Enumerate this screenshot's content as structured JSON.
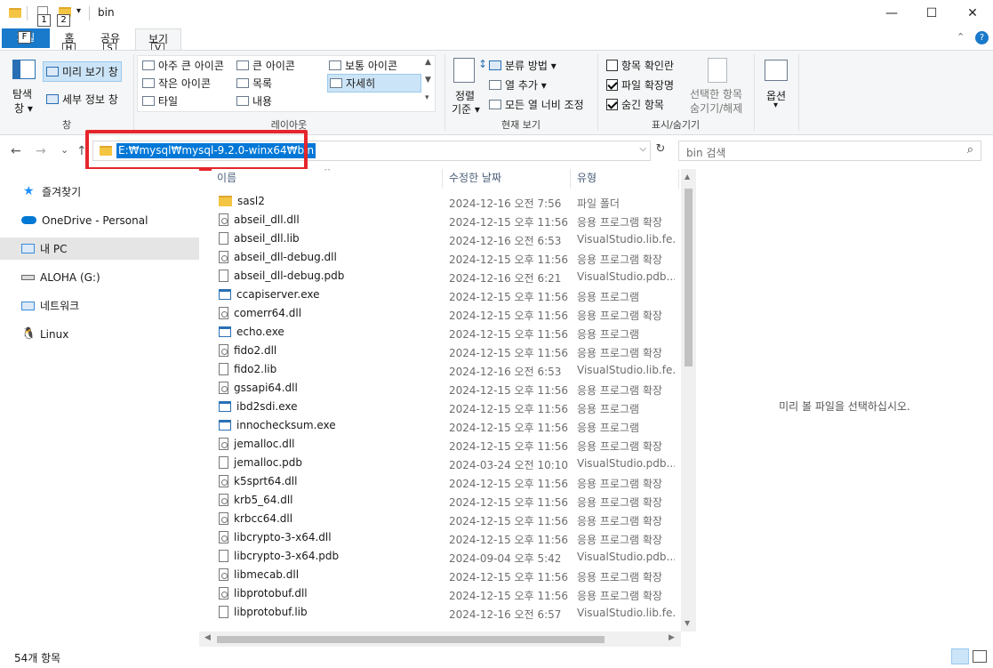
{
  "window": {
    "title": "bin",
    "controls": {
      "minimize": "—",
      "maximize": "☐",
      "close": "✕"
    }
  },
  "quick_access": {
    "keytip_1": "1",
    "keytip_2": "2"
  },
  "ribbon_tabs": {
    "file": "파일",
    "file_keytip": "F",
    "home": "홈",
    "home_keytip": "H",
    "share": "공유",
    "share_keytip": "S",
    "view": "보기",
    "view_keytip": "V"
  },
  "ribbon": {
    "pane_group": {
      "nav_pane": "탐색",
      "nav_pane_2": "창 ▾",
      "preview_pane": "미리 보기 창",
      "details_pane": "세부 정보 창",
      "label": "창"
    },
    "layout_group": {
      "extra_large": "아주 큰 아이콘",
      "large": "큰 아이콘",
      "medium": "보통 아이콘",
      "small": "작은 아이콘",
      "list": "목록",
      "details": "자세히",
      "tiles": "타일",
      "content": "내용",
      "label": "레이아웃"
    },
    "current_view_group": {
      "sort_by": "정렬",
      "sort_by_2": "기준 ▾",
      "group_by": "분류 방법 ▾",
      "add_columns": "열 추가 ▾",
      "size_all_columns": "모든 열 너비 조정",
      "label": "현재 보기"
    },
    "show_hide_group": {
      "item_checkboxes": "항목 확인란",
      "file_extensions": "파일 확장명",
      "hidden_items": "숨긴 항목",
      "hide_selected": "선택한 항목",
      "hide_selected_2": "숨기기/해제",
      "label": "표시/숨기기"
    },
    "options_group": {
      "options": "옵션",
      "options_arrow": "▾"
    }
  },
  "address_bar": {
    "path": "E:₩mysql₩mysql-9.2.0-winx64₩bin",
    "dropdown": "⌵",
    "refresh": "↻"
  },
  "search": {
    "placeholder": "bin 검색",
    "icon": "⌕"
  },
  "nav": {
    "back": "←",
    "forward": "→",
    "recent": "⌄",
    "up": "↑"
  },
  "nav_pane": [
    {
      "label": "즐겨찾기",
      "icon": "star-icon",
      "color": "#1e90ff"
    },
    {
      "label": "OneDrive - Personal",
      "icon": "cloud-icon",
      "color": "#0078d4"
    },
    {
      "label": "내 PC",
      "icon": "computer-icon",
      "color": "#3a8ad8"
    },
    {
      "label": "ALOHA (G:)",
      "icon": "drive-icon",
      "color": "#666666"
    },
    {
      "label": "네트워크",
      "icon": "network-icon",
      "color": "#3a8ad8"
    },
    {
      "label": "Linux",
      "icon": "linux-icon",
      "color": "#222222"
    }
  ],
  "columns": {
    "name": "이름",
    "date": "수정한 날짜",
    "type": "유형",
    "sort_arrow": "^"
  },
  "files": [
    {
      "name": "sasl2",
      "date": "2024-12-16 오전 7:56",
      "type": "파일 폴더",
      "kind": "folder"
    },
    {
      "name": "abseil_dll.dll",
      "date": "2024-12-15 오후 11:56",
      "type": "응용 프로그램 확장",
      "kind": "dll"
    },
    {
      "name": "abseil_dll.lib",
      "date": "2024-12-16 오전 6:53",
      "type": "VisualStudio.lib.fe...",
      "kind": "doc"
    },
    {
      "name": "abseil_dll-debug.dll",
      "date": "2024-12-15 오후 11:56",
      "type": "응용 프로그램 확장",
      "kind": "dll"
    },
    {
      "name": "abseil_dll-debug.pdb",
      "date": "2024-12-16 오전 6:21",
      "type": "VisualStudio.pdb....",
      "kind": "doc"
    },
    {
      "name": "ccapiserver.exe",
      "date": "2024-12-15 오후 11:56",
      "type": "응용 프로그램",
      "kind": "exe"
    },
    {
      "name": "comerr64.dll",
      "date": "2024-12-15 오후 11:56",
      "type": "응용 프로그램 확장",
      "kind": "dll"
    },
    {
      "name": "echo.exe",
      "date": "2024-12-15 오후 11:56",
      "type": "응용 프로그램",
      "kind": "exe"
    },
    {
      "name": "fido2.dll",
      "date": "2024-12-15 오후 11:56",
      "type": "응용 프로그램 확장",
      "kind": "dll"
    },
    {
      "name": "fido2.lib",
      "date": "2024-12-16 오전 6:53",
      "type": "VisualStudio.lib.fe...",
      "kind": "doc"
    },
    {
      "name": "gssapi64.dll",
      "date": "2024-12-15 오후 11:56",
      "type": "응용 프로그램 확장",
      "kind": "dll"
    },
    {
      "name": "ibd2sdi.exe",
      "date": "2024-12-15 오후 11:56",
      "type": "응용 프로그램",
      "kind": "exe"
    },
    {
      "name": "innochecksum.exe",
      "date": "2024-12-15 오후 11:56",
      "type": "응용 프로그램",
      "kind": "exe"
    },
    {
      "name": "jemalloc.dll",
      "date": "2024-12-15 오후 11:56",
      "type": "응용 프로그램 확장",
      "kind": "dll"
    },
    {
      "name": "jemalloc.pdb",
      "date": "2024-03-24 오전 10:10",
      "type": "VisualStudio.pdb....",
      "kind": "doc"
    },
    {
      "name": "k5sprt64.dll",
      "date": "2024-12-15 오후 11:56",
      "type": "응용 프로그램 확장",
      "kind": "dll"
    },
    {
      "name": "krb5_64.dll",
      "date": "2024-12-15 오후 11:56",
      "type": "응용 프로그램 확장",
      "kind": "dll"
    },
    {
      "name": "krbcc64.dll",
      "date": "2024-12-15 오후 11:56",
      "type": "응용 프로그램 확장",
      "kind": "dll"
    },
    {
      "name": "libcrypto-3-x64.dll",
      "date": "2024-12-15 오후 11:56",
      "type": "응용 프로그램 확장",
      "kind": "dll"
    },
    {
      "name": "libcrypto-3-x64.pdb",
      "date": "2024-09-04 오후 5:42",
      "type": "VisualStudio.pdb....",
      "kind": "doc"
    },
    {
      "name": "libmecab.dll",
      "date": "2024-12-15 오후 11:56",
      "type": "응용 프로그램 확장",
      "kind": "dll"
    },
    {
      "name": "libprotobuf.dll",
      "date": "2024-12-15 오후 11:56",
      "type": "응용 프로그램 확장",
      "kind": "dll"
    },
    {
      "name": "libprotobuf.lib",
      "date": "2024-12-16 오전 6:57",
      "type": "VisualStudio.lib.fe...",
      "kind": "doc"
    }
  ],
  "preview": {
    "message": "미리 볼 파일을 선택하십시오."
  },
  "status": {
    "item_count": "54개 항목"
  },
  "colors": {
    "accent": "#0078d7",
    "file_tab": "#1979ca",
    "highlight_box": "#e5262c"
  }
}
